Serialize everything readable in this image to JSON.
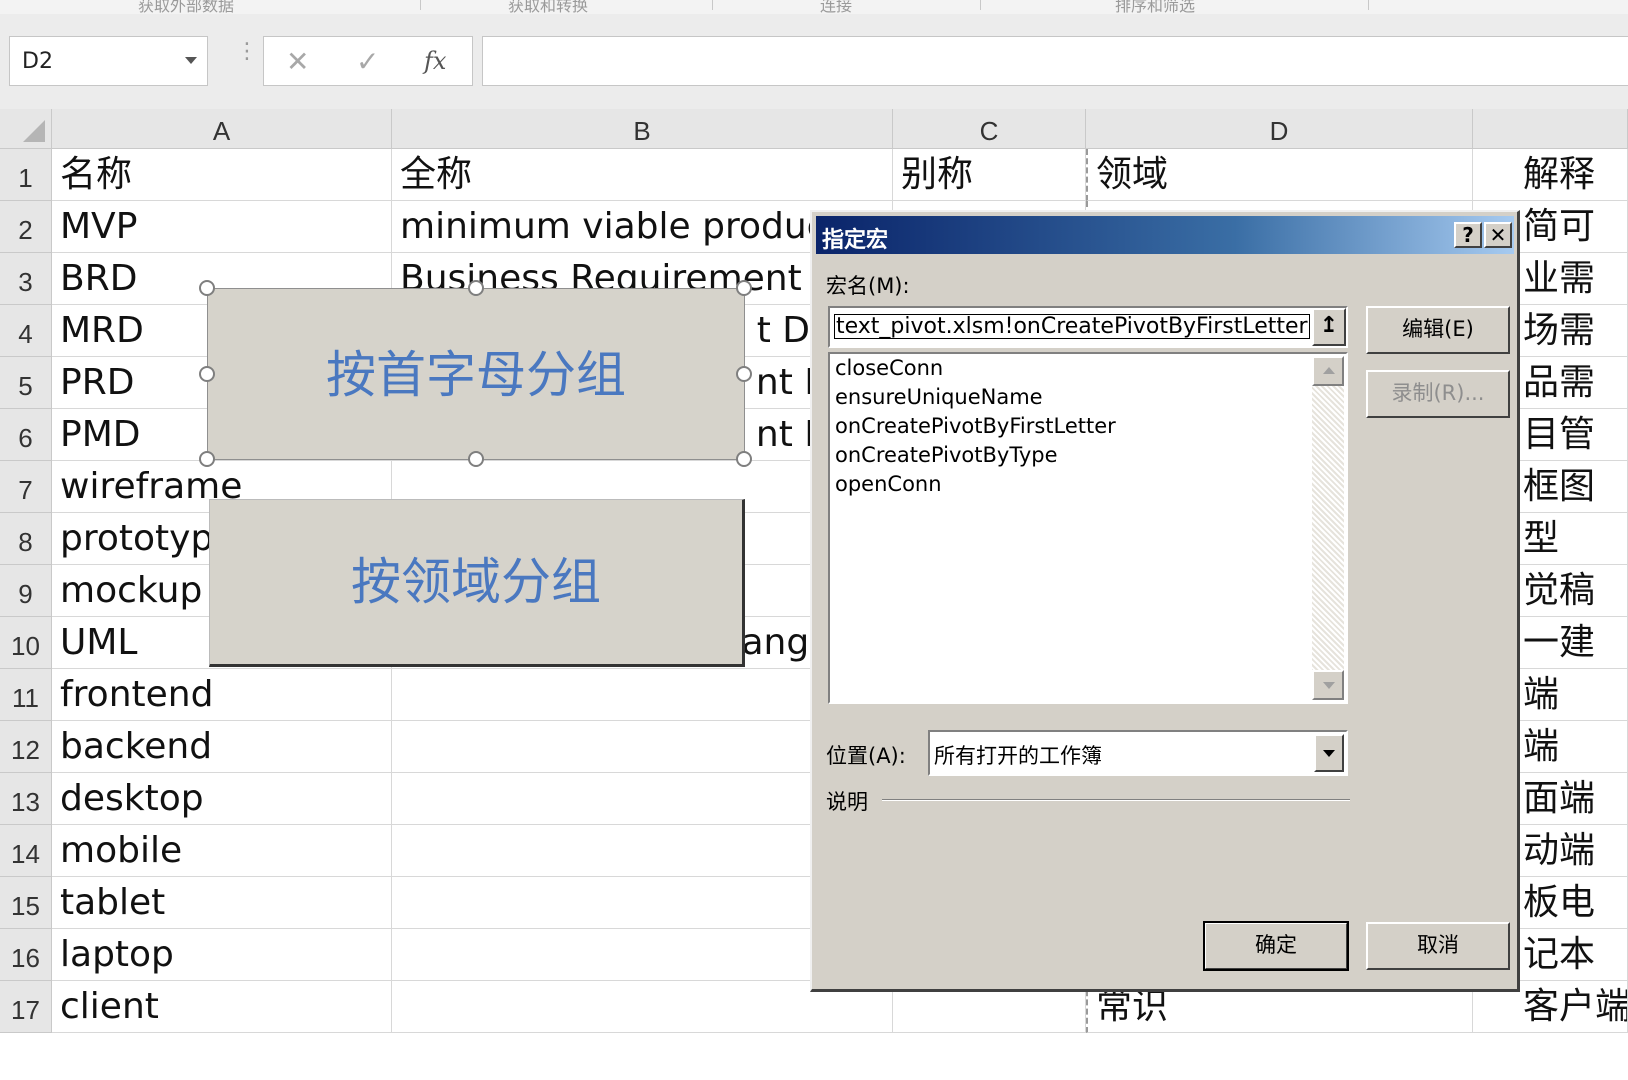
{
  "ribbon": {
    "groups": [
      "获取外部数据",
      "获取和转换",
      "连接",
      "排序和筛选"
    ]
  },
  "formula_bar": {
    "name_box": "D2",
    "cancel_glyph": "✕",
    "enter_glyph": "✓",
    "fx_glyph": "fx",
    "formula": ""
  },
  "sheet": {
    "columns": [
      "A",
      "B",
      "C",
      "D"
    ],
    "row_numbers": [
      "1",
      "2",
      "3",
      "4",
      "5",
      "6",
      "7",
      "8",
      "9",
      "10",
      "11",
      "12",
      "13",
      "14",
      "15",
      "16",
      "17"
    ],
    "header_row": {
      "A": "名称",
      "B": "全称",
      "C": "别称",
      "D": "领域",
      "E": "解释"
    },
    "col_a": [
      "MVP",
      "BRD",
      "MRD",
      "PRD",
      "PMD",
      "wireframe",
      "prototyp",
      "mockup",
      "UML",
      "frontend",
      "backend",
      "desktop",
      "mobile",
      "tablet",
      "laptop",
      "client"
    ],
    "col_b_visible": [
      "minimum viable produc",
      "Business Requirement I",
      "t Do",
      "nt D",
      "nt D",
      "",
      "",
      "",
      "angu",
      "",
      "",
      "",
      "",
      "",
      "",
      ""
    ],
    "col_d_visible": [
      "",
      "",
      "",
      "",
      "",
      "",
      "",
      "",
      "",
      "",
      "",
      "",
      "",
      "",
      "",
      "常识"
    ],
    "col_e_visible": [
      "简可",
      "业需",
      "场需",
      "品需",
      "目管",
      "框图",
      "型",
      "觉稿",
      "一建",
      "端",
      "端",
      "面端",
      "动端",
      "板电",
      "记本",
      "客户端"
    ]
  },
  "shapes": {
    "group_by_first_letter": "按首字母分组",
    "group_by_domain": "按领域分组"
  },
  "dialog": {
    "title": "指定宏",
    "help_button": "?",
    "close_button": "✕",
    "macro_name_label": "宏名(M):",
    "macro_name_value": "text_pivot.xlsm!onCreatePivotByFirstLetter",
    "upload_glyph": "↥",
    "macro_list": [
      "closeConn",
      "ensureUniqueName",
      "onCreatePivotByFirstLetter",
      "onCreatePivotByType",
      "openConn"
    ],
    "edit_button": "编辑(E)",
    "record_button": "录制(R)...",
    "location_label": "位置(A):",
    "location_value": "所有打开的工作簿",
    "description_label": "说明",
    "ok_button": "确定",
    "cancel_button": "取消"
  }
}
